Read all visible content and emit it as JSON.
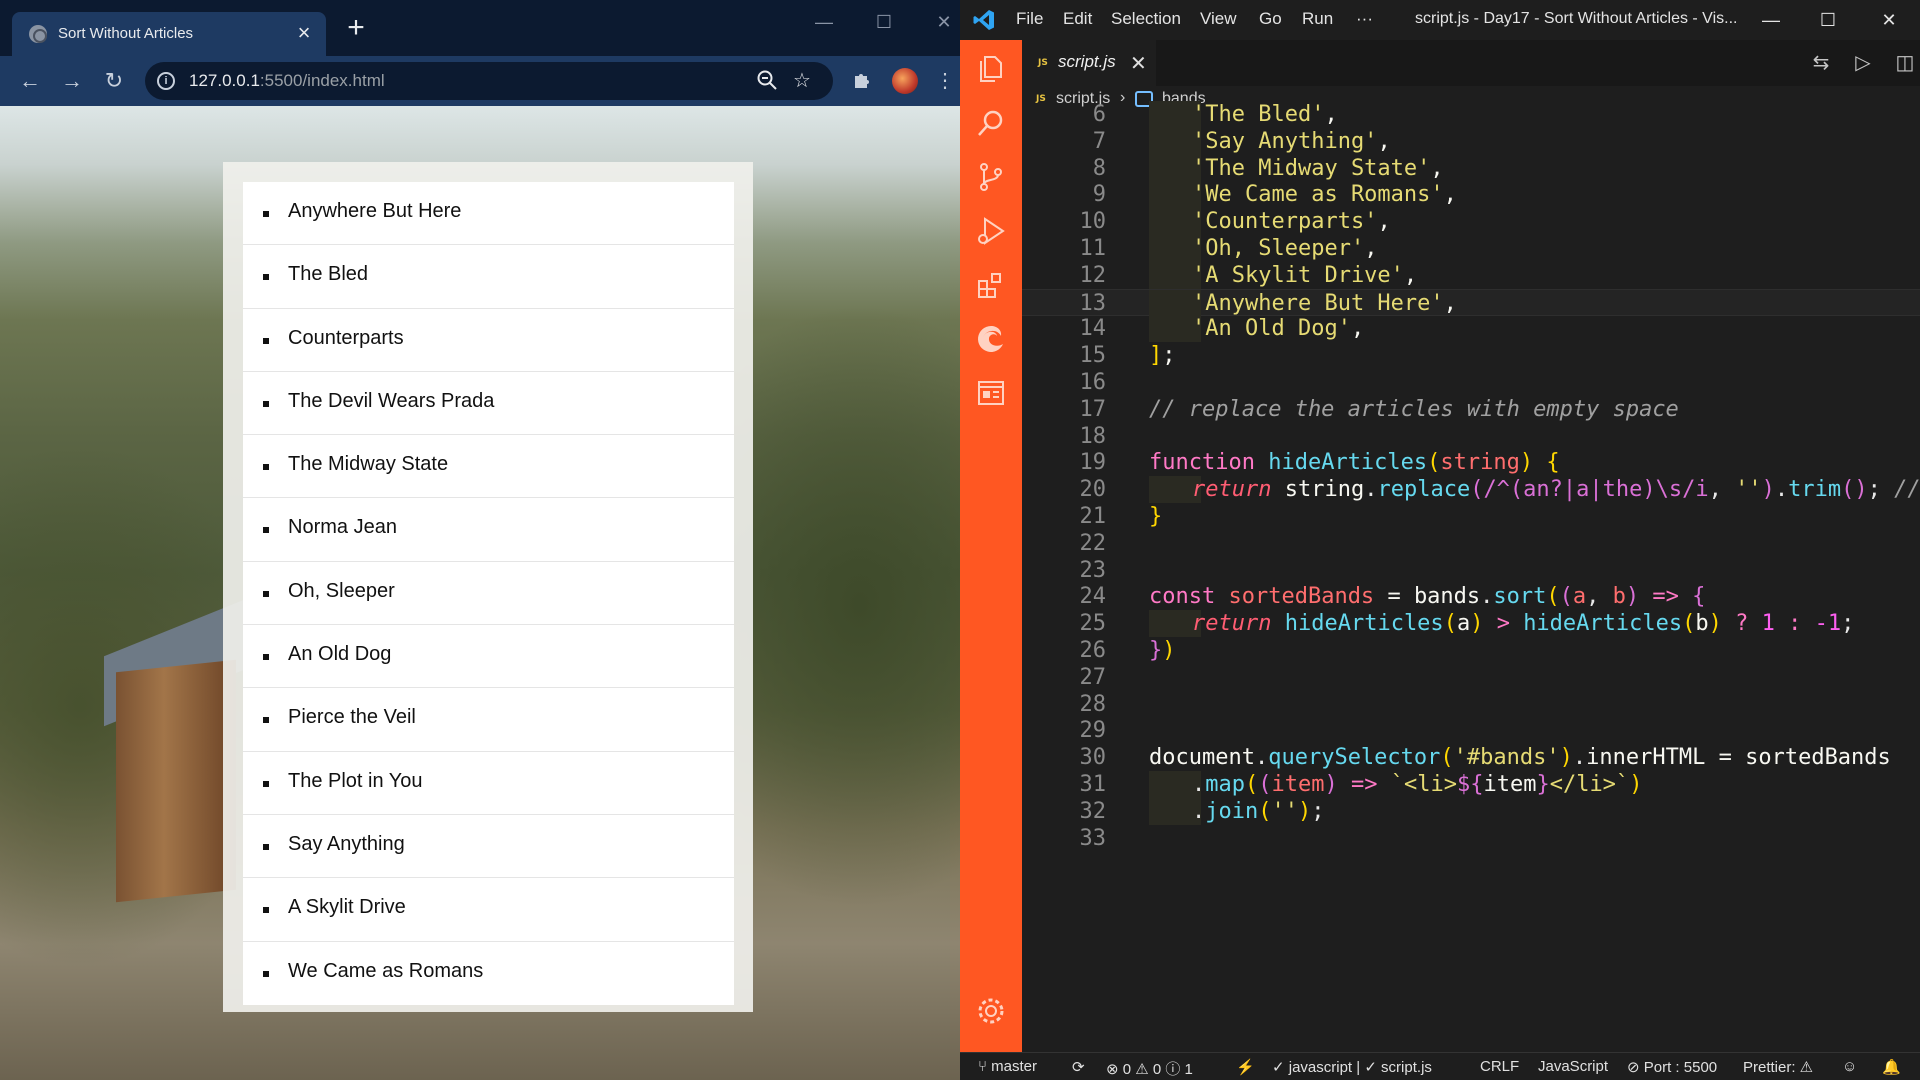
{
  "browser": {
    "tab_title": "Sort Without Articles",
    "url_host": "127.0.0.1",
    "url_rest": ":5500/index.html",
    "window_controls": {
      "minimize": "—",
      "maximize": "☐",
      "close": "✕"
    }
  },
  "page": {
    "bands": [
      "Anywhere But Here",
      "The Bled",
      "Counterparts",
      "The Devil Wears Prada",
      "The Midway State",
      "Norma Jean",
      "Oh, Sleeper",
      "An Old Dog",
      "Pierce the Veil",
      "The Plot in You",
      "Say Anything",
      "A Skylit Drive",
      "We Came as Romans"
    ]
  },
  "vscode": {
    "menu": [
      "File",
      "Edit",
      "Selection",
      "View",
      "Go",
      "Run",
      "···"
    ],
    "window_title": "script.js - Day17 - Sort Without Articles - Vis...",
    "tab_label": "script.js",
    "tab_badge": "JS",
    "breadcrumb_file": "script.js",
    "breadcrumb_symbol": "bands",
    "line_numbers": [
      "6",
      "7",
      "8",
      "9",
      "10",
      "11",
      "12",
      "13",
      "14",
      "15",
      "16",
      "17",
      "18",
      "19",
      "20",
      "21",
      "22",
      "23",
      "24",
      "25",
      "26",
      "27",
      "28",
      "29",
      "30",
      "31",
      "32",
      "33"
    ],
    "comment": "// replace the articles with empty space",
    "status": {
      "branch": "master",
      "problems": "⊗ 0 ⚠ 0 ⓘ 1",
      "linter": "✓ javascript | ✓ script.js",
      "eol": "CRLF",
      "language": "JavaScript",
      "port": "Port : 5500",
      "prettier": "Prettier:"
    },
    "colors": {
      "activity_bar": "#ff5722",
      "editor_bg": "#1e1e1e"
    }
  }
}
